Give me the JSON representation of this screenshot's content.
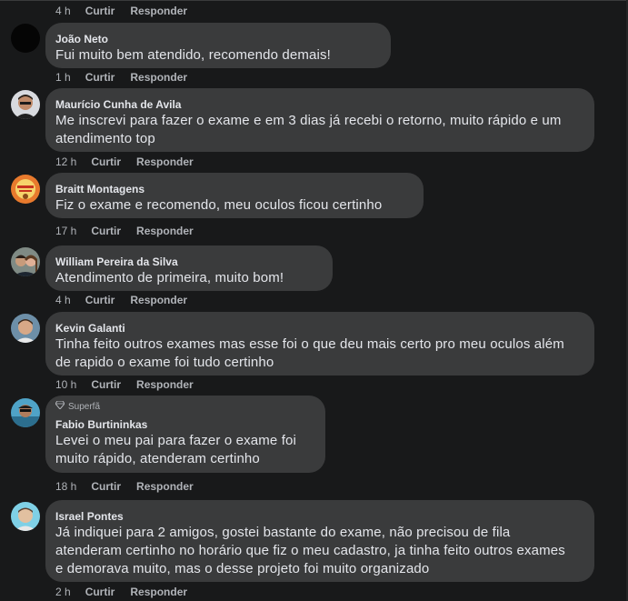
{
  "top_actions": {
    "time": "4 h",
    "like": "Curtir",
    "reply": "Responder"
  },
  "comments": [
    {
      "author": "João Neto",
      "text": "Fui muito bem atendido, recomendo demais!",
      "time": "1 h",
      "like": "Curtir",
      "reply": "Responder"
    },
    {
      "author": "Maurício Cunha de Avila",
      "text": "Me inscrevi para fazer o exame e em 3 dias já recebi o retorno, muito rápido e um atendimento top",
      "time": "12 h",
      "like": "Curtir",
      "reply": "Responder"
    },
    {
      "author": "Braitt Montagens",
      "text": "Fiz o exame e recomendo, meu oculos ficou certinho",
      "time": "17 h",
      "like": "Curtir",
      "reply": "Responder"
    },
    {
      "author": "William Pereira da Silva",
      "text": "Atendimento de primeira, muito bom!",
      "time": "4 h",
      "like": "Curtir",
      "reply": "Responder"
    },
    {
      "author": "Kevin Galanti",
      "text": "Tinha feito outros exames mas esse foi o que deu mais certo pro meu oculos além de rapido o exame foi tudo certinho",
      "time": "10 h",
      "like": "Curtir",
      "reply": "Responder"
    },
    {
      "badge": "Superfã",
      "author": "Fabio Burtininkas",
      "text": "Levei o meu pai para fazer o exame foi muito rápido, atenderam certinho",
      "time": "18 h",
      "like": "Curtir",
      "reply": "Responder"
    },
    {
      "author": "Israel Pontes",
      "text": "Já indiquei para 2 amigos, gostei bastante do exame, não precisou de fila atenderam certinho no horário que fiz o meu cadastro, ja tinha feito outros exames e demorava muito, mas o desse projeto foi muito organizado",
      "time": "2 h",
      "like": "Curtir",
      "reply": "Responder"
    }
  ],
  "colors": {
    "background": "#18191a",
    "bubble": "#3a3b3c",
    "text": "#e4e6eb",
    "secondary": "#b0b3b8"
  }
}
